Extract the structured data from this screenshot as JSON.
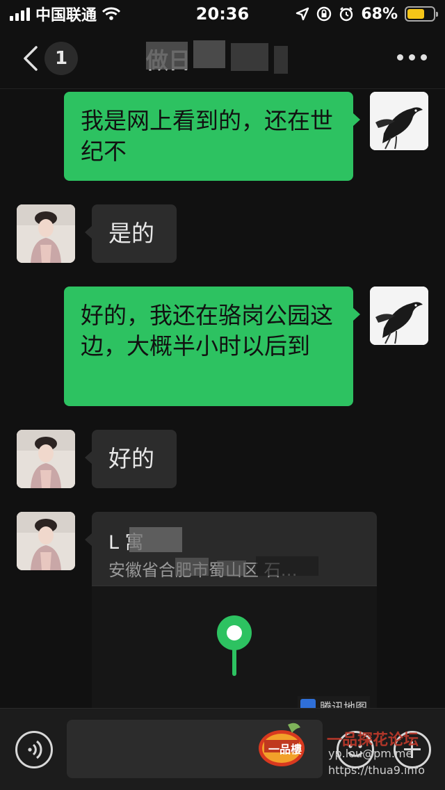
{
  "status_bar": {
    "carrier": "中国联通",
    "time": "20:36",
    "battery_percent": "68%",
    "battery_level": 0.68,
    "battery_color": "#f5c518",
    "icons": [
      "signal-icon",
      "wifi-icon",
      "location-arrow-icon",
      "orientation-lock-icon",
      "alarm-icon",
      "battery-icon"
    ]
  },
  "nav": {
    "unread_count": "1",
    "title": "做日",
    "icons": [
      "back-chevron-icon",
      "more-icon"
    ]
  },
  "messages": [
    {
      "side": "out",
      "text": "我是网上看到的，还在世纪不",
      "avatar": "raven"
    },
    {
      "side": "in",
      "text": "是的",
      "avatar": "lady"
    },
    {
      "side": "out",
      "text": "好的，我还在骆岗公园这边，大概半小时以后到",
      "avatar": "raven"
    },
    {
      "side": "in",
      "text": "好的",
      "avatar": "lady"
    }
  ],
  "location_card": {
    "name": "L 寓",
    "address": "安徽省合肥市蜀山区 石…",
    "map_brand": "腾讯地图"
  },
  "input_bar": {
    "icons": [
      "voice-icon",
      "emoji-icon",
      "plus-icon"
    ]
  },
  "colors": {
    "outgoing_bubble": "#2dc261",
    "incoming_bubble": "#2c2c2c",
    "background": "#111111",
    "pin": "#2dc261"
  },
  "watermark": {
    "logo_text": "一品樓",
    "title": "一品探花论坛",
    "url1": "yp.lou@pm.me",
    "url2": "https://thua9.info"
  }
}
